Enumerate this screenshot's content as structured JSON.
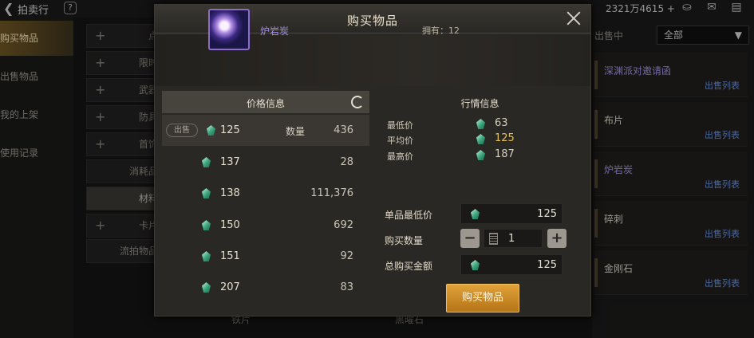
{
  "header": {
    "title": "拍卖行",
    "help_label": "?",
    "currency": "2321万4615 +"
  },
  "sidebar": {
    "items": [
      {
        "label": "购买物品"
      },
      {
        "label": "出售物品"
      },
      {
        "label": "我的上架"
      },
      {
        "label": "使用记录"
      }
    ]
  },
  "categories": [
    {
      "label": "点",
      "plus": "+"
    },
    {
      "label": "限时",
      "plus": "+"
    },
    {
      "label": "武器",
      "plus": "+"
    },
    {
      "label": "防具",
      "plus": "+"
    },
    {
      "label": "首饰",
      "plus": "+"
    },
    {
      "label": "消耗品",
      "plus": ""
    },
    {
      "label": "材料",
      "plus": ""
    },
    {
      "label": "卡片",
      "plus": "+"
    },
    {
      "label": "流拍物品",
      "plus": ""
    }
  ],
  "right_panel": {
    "sell_label": "出售中",
    "filter_value": "全部",
    "rows": [
      {
        "name": "深渊派对邀请函",
        "action": "出售列表",
        "name_color": "#a48fe6"
      },
      {
        "name": "布片",
        "action": "出售列表",
        "name_color": "#d8d2c4"
      },
      {
        "name": "炉岩炭",
        "action": "出售列表",
        "name_color": "#a48fe6"
      },
      {
        "name": "碎刺",
        "action": "出售列表",
        "name_color": "#d8d2c4"
      },
      {
        "name": "金刚石",
        "action": "出售列表",
        "name_color": "#d8d2c4"
      }
    ]
  },
  "bottom_items": [
    "铁片",
    "黑曜石"
  ],
  "modal": {
    "title": "购买物品",
    "item": {
      "name": "炉岩炭",
      "owned": "拥有：12"
    },
    "price_table": {
      "title": "价格信息",
      "sell_tag": "出售",
      "qty_label": "数量",
      "rows": [
        {
          "price": "125",
          "qty": "436"
        },
        {
          "price": "137",
          "qty": "28"
        },
        {
          "price": "138",
          "qty": "111,376"
        },
        {
          "price": "150",
          "qty": "692"
        },
        {
          "price": "151",
          "qty": "92"
        },
        {
          "price": "207",
          "qty": "83"
        }
      ]
    },
    "market": {
      "title": "行情信息",
      "rows": [
        {
          "label": "最低价",
          "value": "63",
          "color": "#d5cebf"
        },
        {
          "label": "平均价",
          "value": "125",
          "color": "#e5c15a"
        },
        {
          "label": "最高价",
          "value": "187",
          "color": "#d5cebf"
        }
      ]
    },
    "form": {
      "unit_min_label": "单品最低价",
      "unit_min_value": "125",
      "qty_label": "购买数量",
      "qty_value": "1",
      "minus": "−",
      "plus": "+",
      "total_label": "总购买金额",
      "total_value": "125"
    },
    "buy_button": "购买物品"
  },
  "colors": {
    "accent": "#d89a30",
    "item_name": "#a48fe6",
    "list_link": "#6d8fd6"
  }
}
